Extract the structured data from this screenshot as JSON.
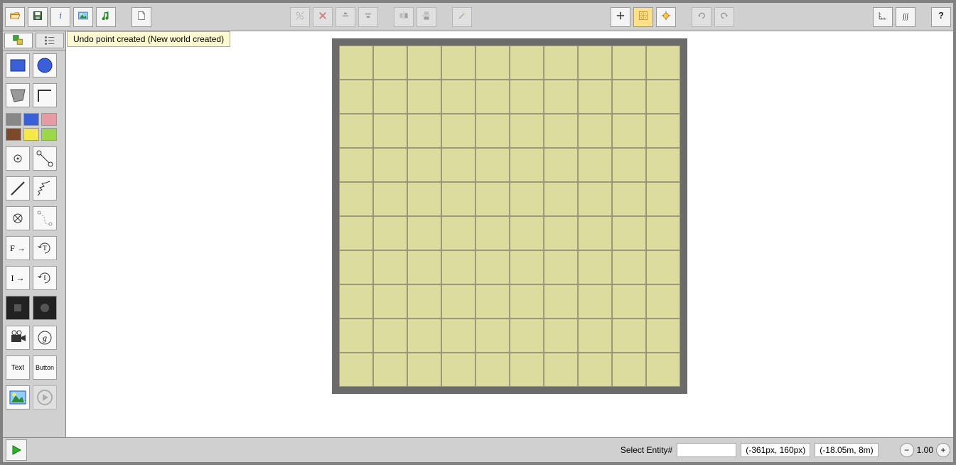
{
  "notification": "Undo point created (New world created)",
  "status": {
    "select_entity_label": "Select Entity#",
    "select_entity_value": "",
    "coord_px": "(-361px, 160px)",
    "coord_m": "(-18.05m, 8m)",
    "zoom": "1.00"
  },
  "palette": {
    "text_label": "Text",
    "button_label": "Button",
    "force_label": "F →",
    "impulse_label": "I →"
  },
  "colors": {
    "world_bg": "#dcdc9e",
    "frame": "#6b6b6b",
    "toolbar": "#d0d0d0"
  },
  "world": {
    "cols": 10,
    "rows": 10
  }
}
